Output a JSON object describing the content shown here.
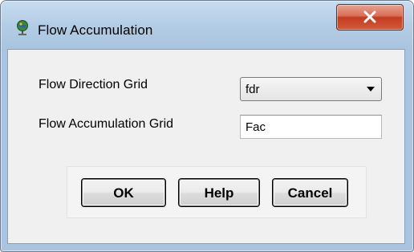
{
  "window": {
    "title": "Flow Accumulation",
    "app_icon": "globe-pin-icon",
    "close_icon": "close-icon",
    "close_color": "#c53c21"
  },
  "form": {
    "flow_direction_label": "Flow Direction Grid",
    "flow_direction_value": "fdr",
    "flow_accumulation_label": "Flow Accumulation Grid",
    "flow_accumulation_value": "Fac"
  },
  "buttons": {
    "ok": "OK",
    "help": "Help",
    "cancel": "Cancel"
  }
}
